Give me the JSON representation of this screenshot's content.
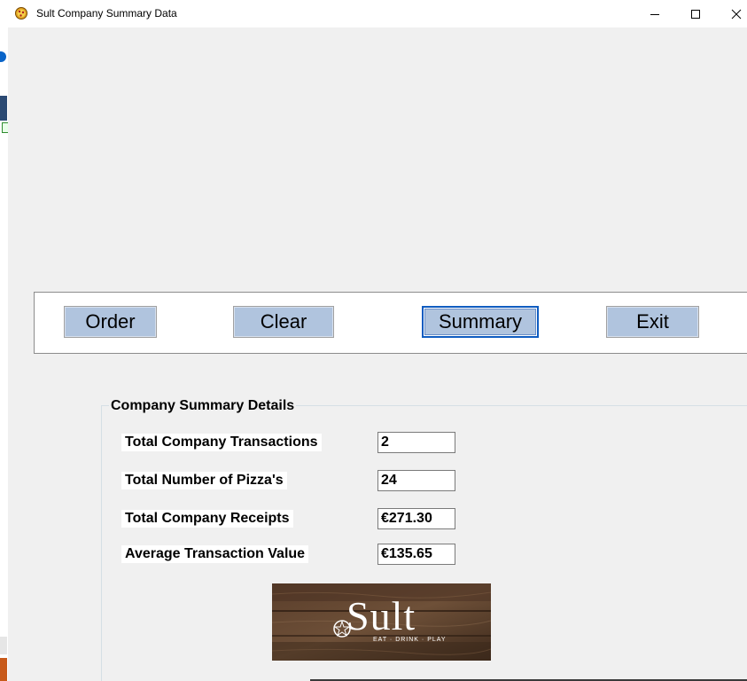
{
  "window": {
    "title": "Sult Company Summary Data",
    "controls": {
      "minimize_icon": "minimize-icon",
      "maximize_icon": "maximize-icon",
      "close_icon": "close-icon"
    }
  },
  "toolbar": {
    "order_label": "Order",
    "clear_label": "Clear",
    "summary_label": "Summary",
    "exit_label": "Exit",
    "button_color": "#b0c4de",
    "focus_color": "#0f5cc0"
  },
  "summary": {
    "group_title": "Company Summary Details",
    "fields": [
      {
        "label": "Total Company Transactions",
        "value": "2"
      },
      {
        "label": "Total Number of Pizza's",
        "value": "24"
      },
      {
        "label": "Total Company  Receipts",
        "value": "€271.30"
      },
      {
        "label": "Average Transaction Value",
        "value": "€135.65"
      }
    ]
  },
  "logo": {
    "name": "Sult",
    "tagline": "EAT · DRINK · PLAY"
  }
}
